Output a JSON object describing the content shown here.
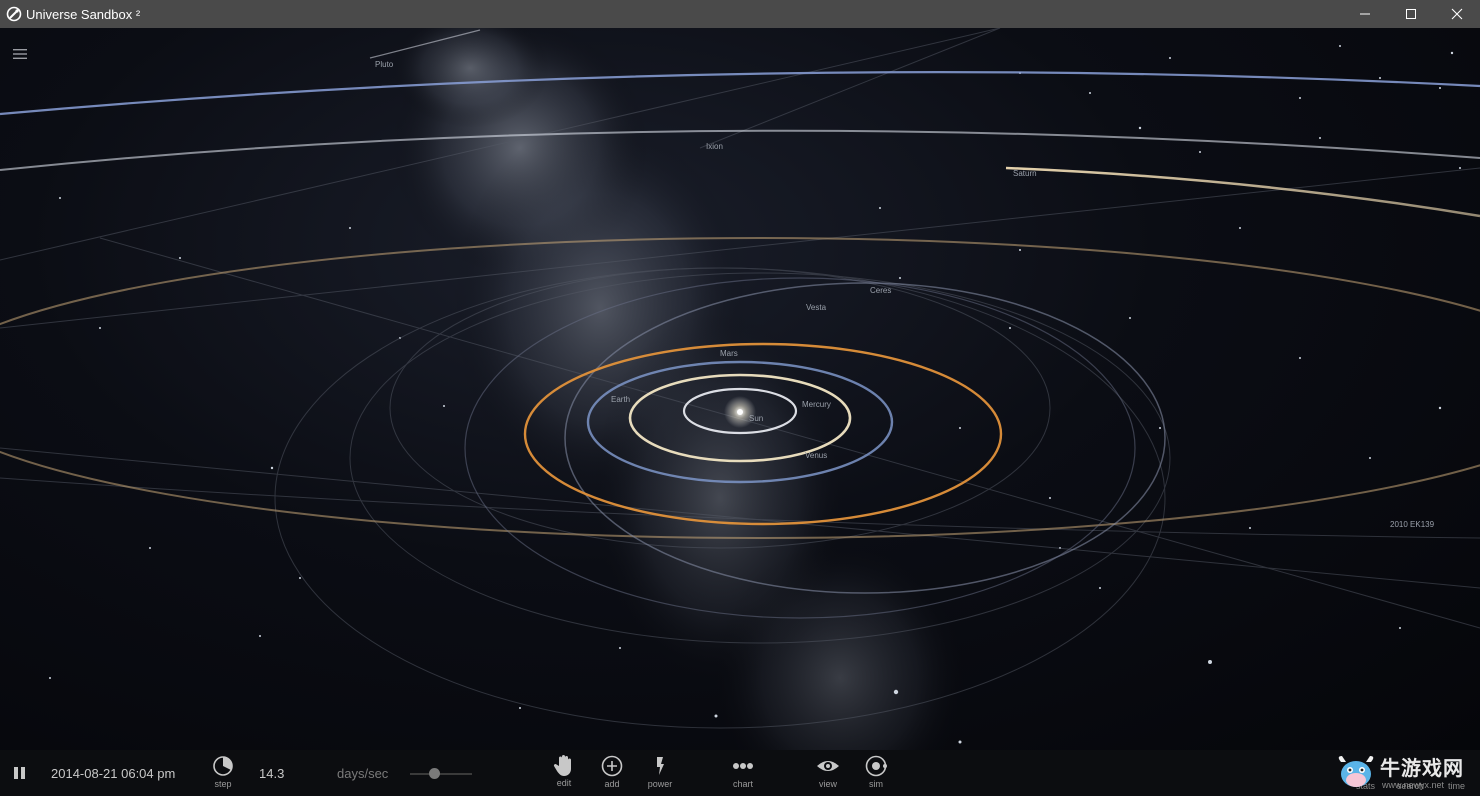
{
  "window": {
    "title": "Universe Sandbox ²"
  },
  "labels": {
    "pluto": "Pluto",
    "ixion": "Ixion",
    "saturn": "Saturn",
    "ceres": "Ceres",
    "vesta": "Vesta",
    "mars": "Mars",
    "earth": "Earth",
    "mercury": "Mercury",
    "sun": "Sun",
    "venus": "Venus",
    "ek139": "2010 EK139"
  },
  "bottombar": {
    "datetime": "2014-08-21 06:04 pm",
    "step_label": "step",
    "speed_value": "14.3",
    "speed_unit": "days/sec",
    "slider_fraction": 0.4,
    "edit_label": "edit",
    "add_label": "add",
    "power_label": "power",
    "chart_label": "chart",
    "view_label": "view",
    "sim_label": "sim",
    "stats_label": "stats",
    "search_label": "search",
    "time_label": "time"
  },
  "watermark": {
    "brand": "牛游戏网",
    "url": "www.newyx.net"
  },
  "colors": {
    "mars_orbit": "#e0913a",
    "earth_orbit": "#7d95c8",
    "venus_orbit": "#f2e6c4",
    "saturn_orbit": "#f0dcb4",
    "outer_orbit": "#8aa0d8",
    "titlebar": "#4a4a4a",
    "bottombar": "#0c0d10"
  }
}
